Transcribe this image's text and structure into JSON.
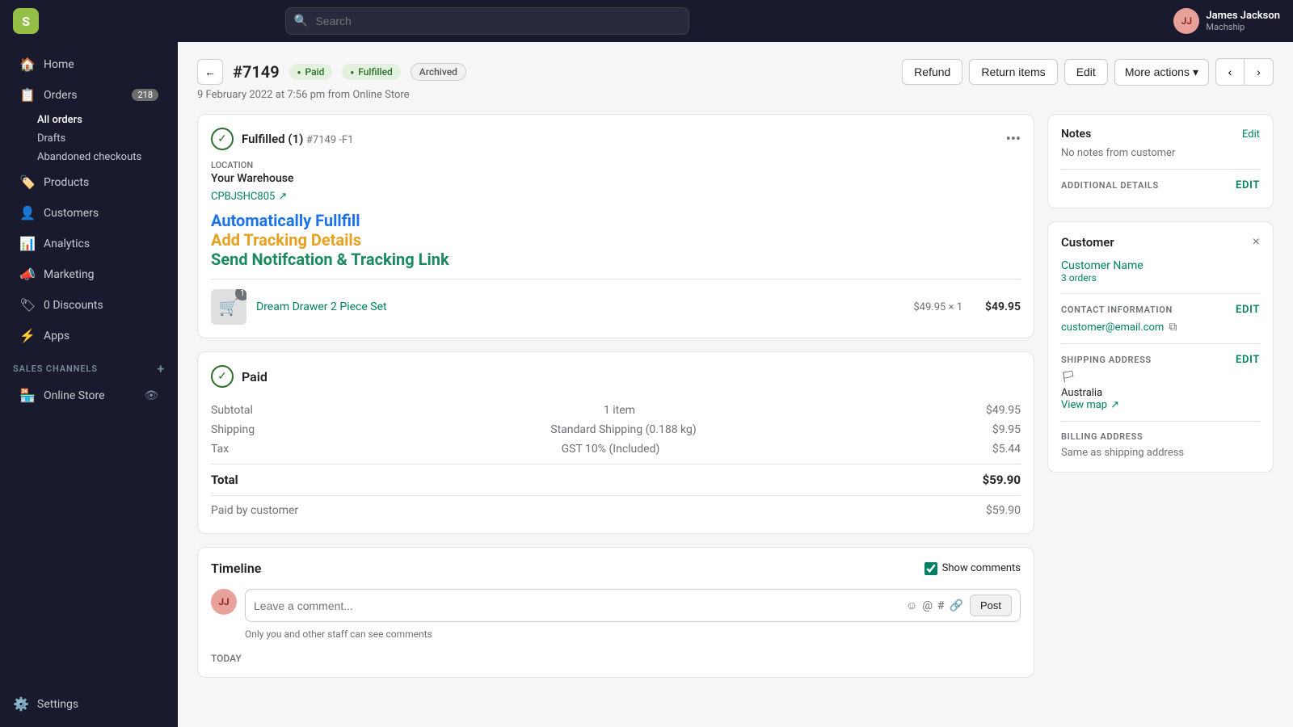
{
  "topnav": {
    "logo": "S",
    "search_placeholder": "Search",
    "user_initials": "JJ",
    "user_name": "James Jackson",
    "user_shop": "Machship"
  },
  "sidebar": {
    "home": "Home",
    "orders": "Orders",
    "orders_badge": "218",
    "orders_sub": {
      "all_orders": "All orders",
      "drafts": "Drafts",
      "abandoned": "Abandoned checkouts"
    },
    "products": "Products",
    "customers": "Customers",
    "analytics": "Analytics",
    "marketing": "Marketing",
    "discounts": "0 Discounts",
    "apps": "Apps",
    "sales_channels_label": "SALES CHANNELS",
    "online_store": "Online Store",
    "settings": "Settings"
  },
  "order": {
    "back_label": "←",
    "id": "#7149",
    "badge_paid": "Paid",
    "badge_fulfilled": "Fulfilled",
    "badge_archived": "Archived",
    "date": "9 February 2022 at 7:56 pm from Online Store",
    "refund_btn": "Refund",
    "return_btn": "Return items",
    "edit_btn": "Edit",
    "more_actions": "More actions",
    "nav_prev": "‹",
    "nav_next": "›"
  },
  "fulfillment": {
    "status": "Fulfilled (1)",
    "order_ref": "#7149 -F1",
    "menu_icon": "•••",
    "location_label": "Location",
    "location_name": "Your Warehouse",
    "tracking_code": "CPBJSHC805",
    "tracking_icon": "↗",
    "promo_line1": "Automatically Fullfill",
    "promo_line2": "Add Tracking Details",
    "promo_line3": "Send Notifcation & Tracking Link",
    "product_name": "Dream Drawer 2 Piece Set",
    "product_qty": "1",
    "product_unit_price": "$49.95",
    "product_qty_label": "× 1",
    "product_total": "$49.95",
    "product_icon": "🛒"
  },
  "payment": {
    "status": "Paid",
    "subtotal_label": "Subtotal",
    "subtotal_qty": "1 item",
    "subtotal_amount": "$49.95",
    "shipping_label": "Shipping",
    "shipping_method": "Standard Shipping (0.188 kg)",
    "shipping_amount": "$9.95",
    "tax_label": "Tax",
    "tax_method": "GST 10% (Included)",
    "tax_amount": "$5.44",
    "total_label": "Total",
    "total_amount": "$59.90",
    "paid_by_label": "Paid by customer",
    "paid_by_amount": "$59.90"
  },
  "timeline": {
    "title": "Timeline",
    "show_comments_label": "Show comments",
    "user_initials": "JJ",
    "comment_placeholder": "Leave a comment...",
    "post_btn": "Post",
    "comment_hint": "Only you and other staff can see comments",
    "today_label": "TODAY",
    "emoji_icon": "☺",
    "mention_icon": "@",
    "tag_icon": "#",
    "link_icon": "🔗"
  },
  "notes_panel": {
    "title": "Notes",
    "edit_label": "Edit",
    "empty_text": "No notes from customer",
    "additional_title": "ADDITIONAL DETAILS",
    "additional_edit": "Edit"
  },
  "customer_panel": {
    "title": "Customer",
    "close_icon": "×",
    "customer_name": "Customer Name",
    "orders_count": "3 orders",
    "contact_title": "CONTACT INFORMATION",
    "contact_edit": "Edit",
    "contact_email": "customer@email.com",
    "copy_icon": "⧉",
    "shipping_title": "SHIPPING ADDRESS",
    "shipping_edit": "Edit",
    "address_flag": "🏳",
    "address_country": "Australia",
    "view_map_label": "View map",
    "view_map_icon": "↗",
    "billing_title": "BILLING ADDRESS",
    "billing_same": "Same as shipping address"
  }
}
